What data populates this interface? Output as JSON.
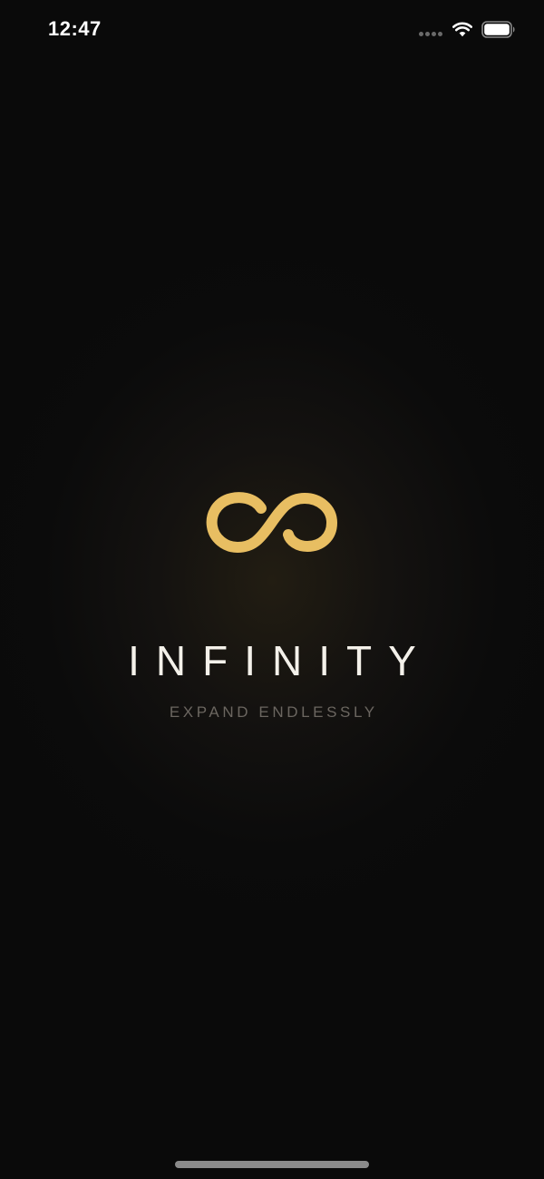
{
  "status_bar": {
    "time": "12:47",
    "signal_icon": "cellular-dots-icon",
    "wifi_icon": "wifi-icon",
    "battery_icon": "battery-icon"
  },
  "splash": {
    "logo_icon": "infinity-logo-icon",
    "title": "INFINITY",
    "tagline": "EXPAND ENDLESSLY"
  },
  "colors": {
    "accent_gold": "#E8BE62",
    "background": "#0A0A0A",
    "title_color": "#F4F1EA",
    "tagline_color": "#6B6660"
  }
}
